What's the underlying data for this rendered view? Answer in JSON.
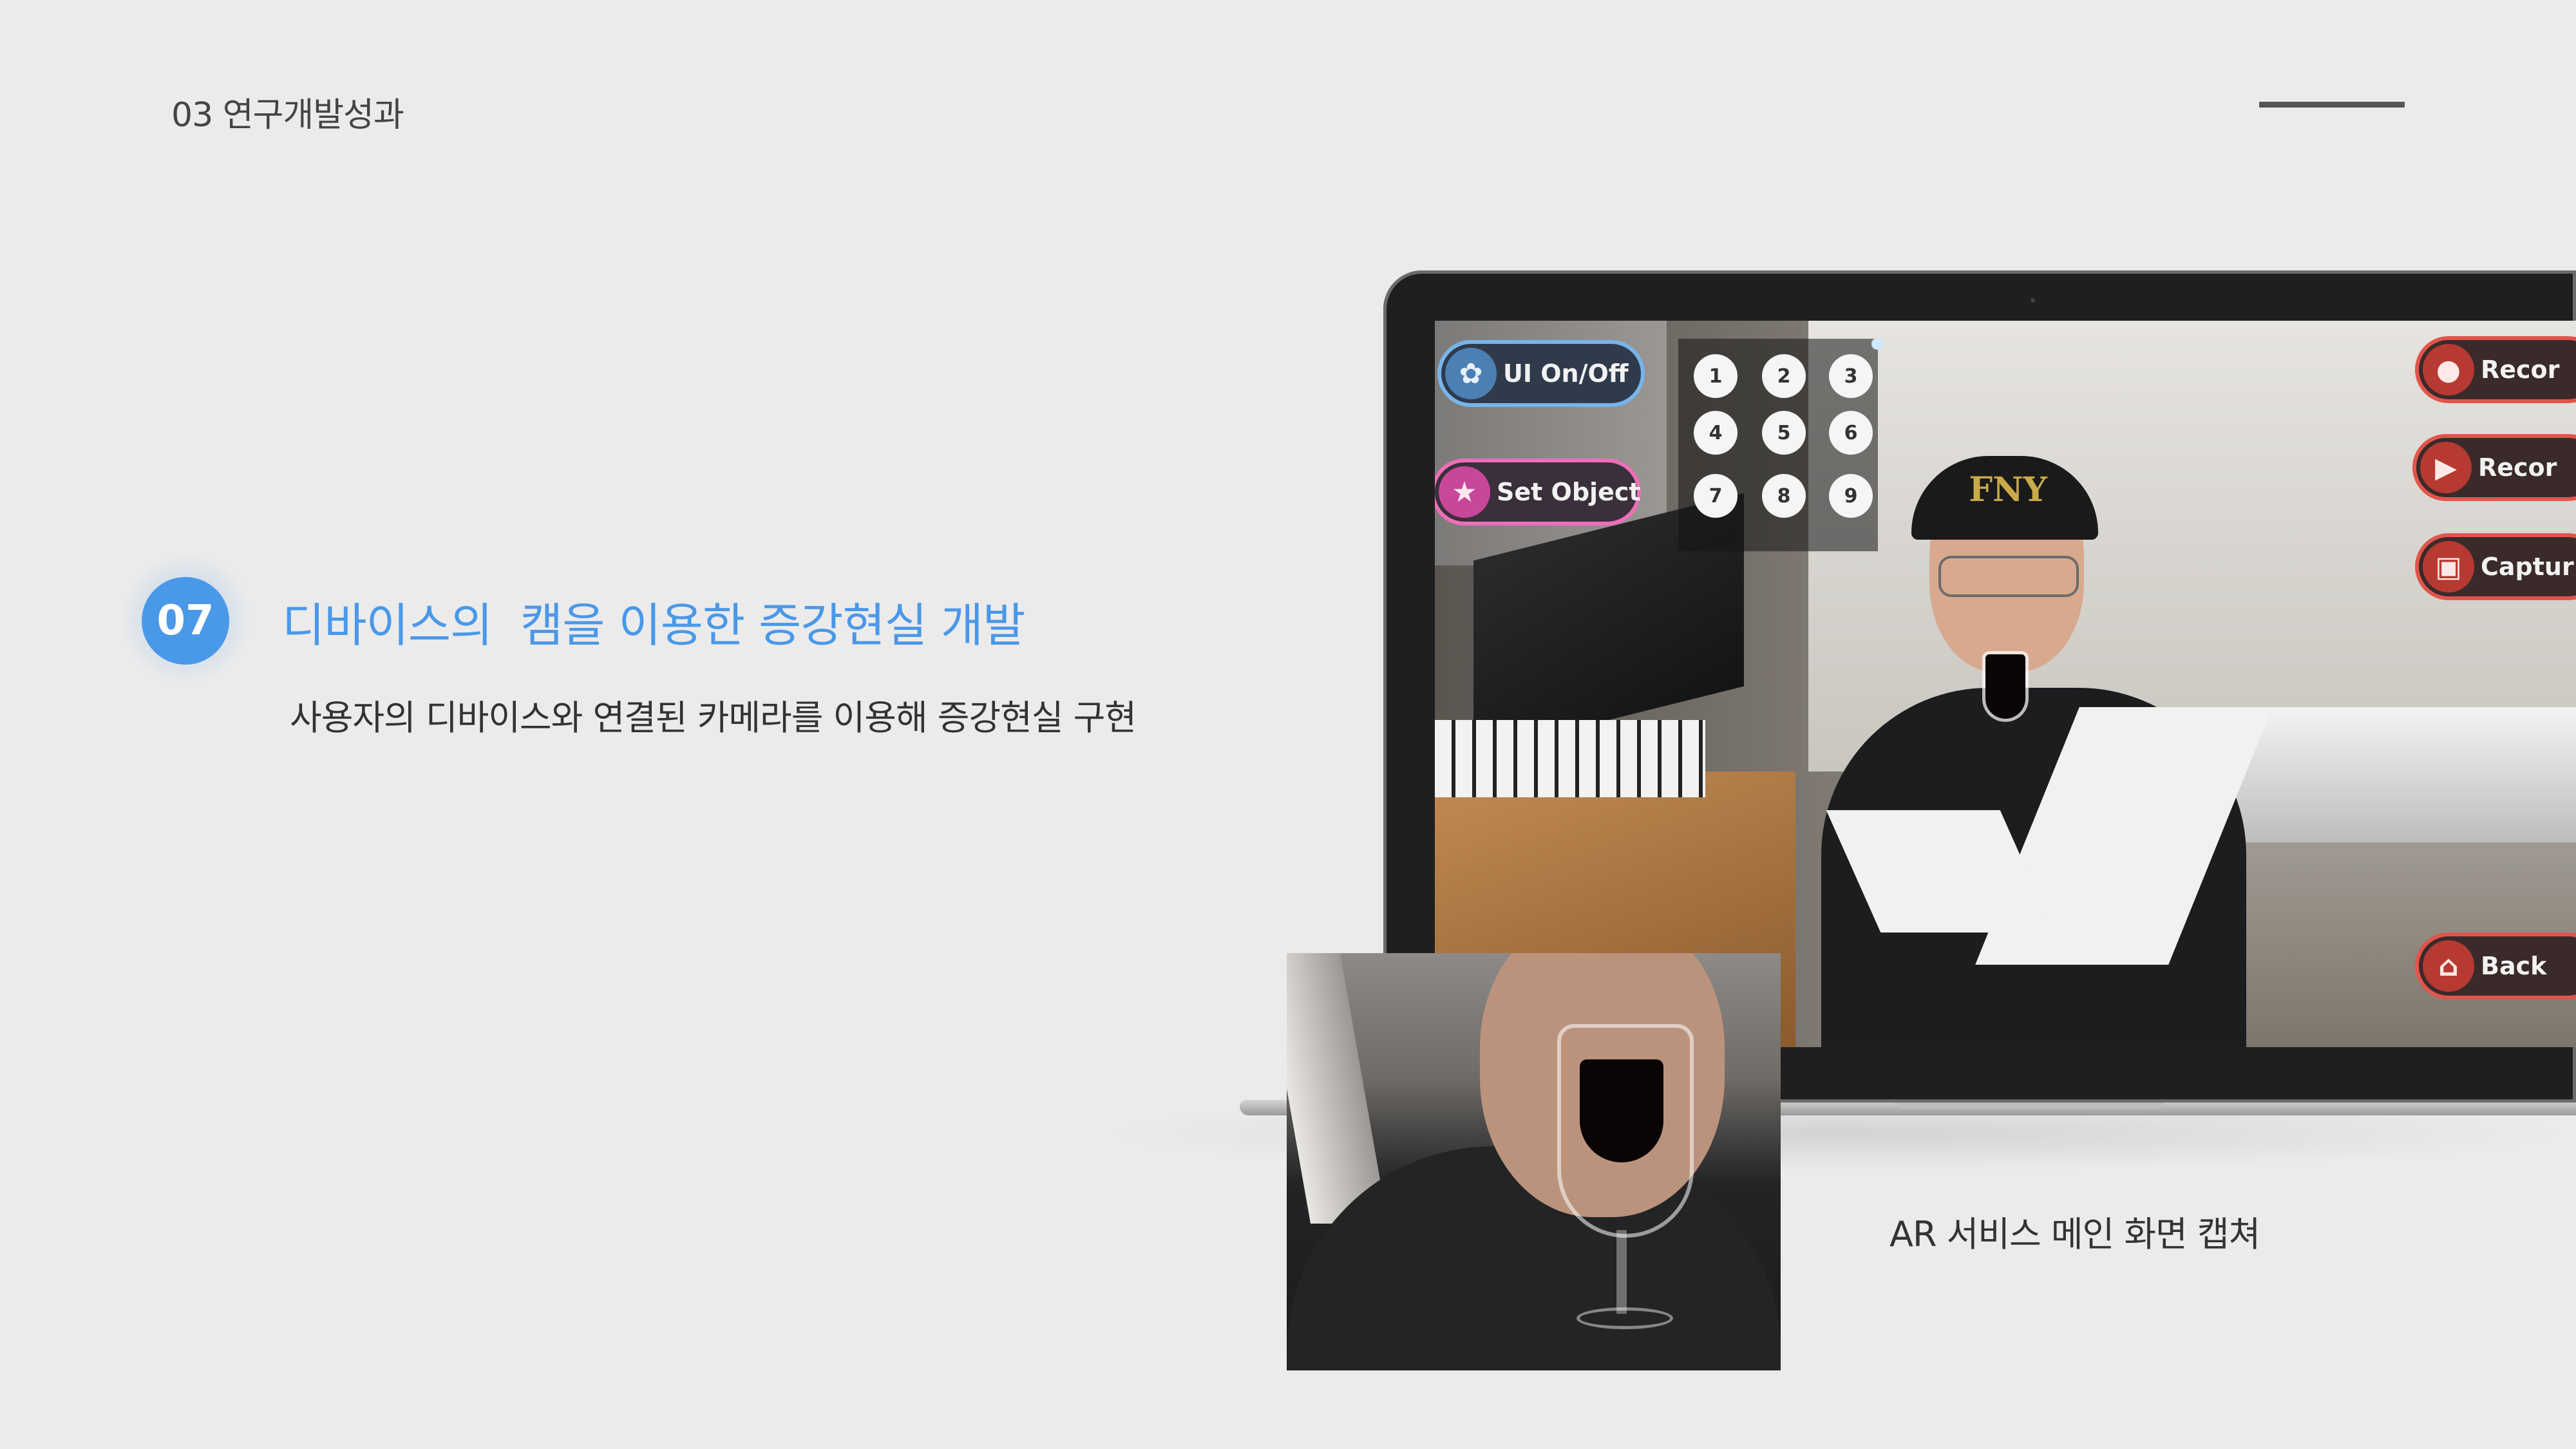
{
  "header": {
    "section_label": "03 연구개발성과"
  },
  "item": {
    "number": "07",
    "title": "디바이스의  캠을 이용한 증강현실 개발",
    "description": "사용자의 디바이스와 연결된 카메라를 이용해 증강현실 구현"
  },
  "figure": {
    "caption": "AR 서비스 메인 화면 캡쳐"
  },
  "ar_ui": {
    "ui_toggle_label": "UI On/Off",
    "set_object_label": "Set Object",
    "record_label": "Recor",
    "record_play_label": "Recor",
    "capture_label": "Captur",
    "back_label": "Back",
    "numpad": [
      "1",
      "2",
      "3",
      "4",
      "5",
      "6",
      "7",
      "8",
      "9"
    ],
    "cap_text": "FNY"
  },
  "icons": {
    "ui_toggle": "gear-icon",
    "set_object": "star-icon",
    "record": "microphone-icon",
    "record_play": "play-icon",
    "capture": "image-icon",
    "back": "home-icon"
  },
  "colors": {
    "accent": "#4a98e8",
    "ui_blue": "#77b4ea",
    "ui_pink": "#ec6fb8",
    "ui_red": "#e2544b"
  }
}
